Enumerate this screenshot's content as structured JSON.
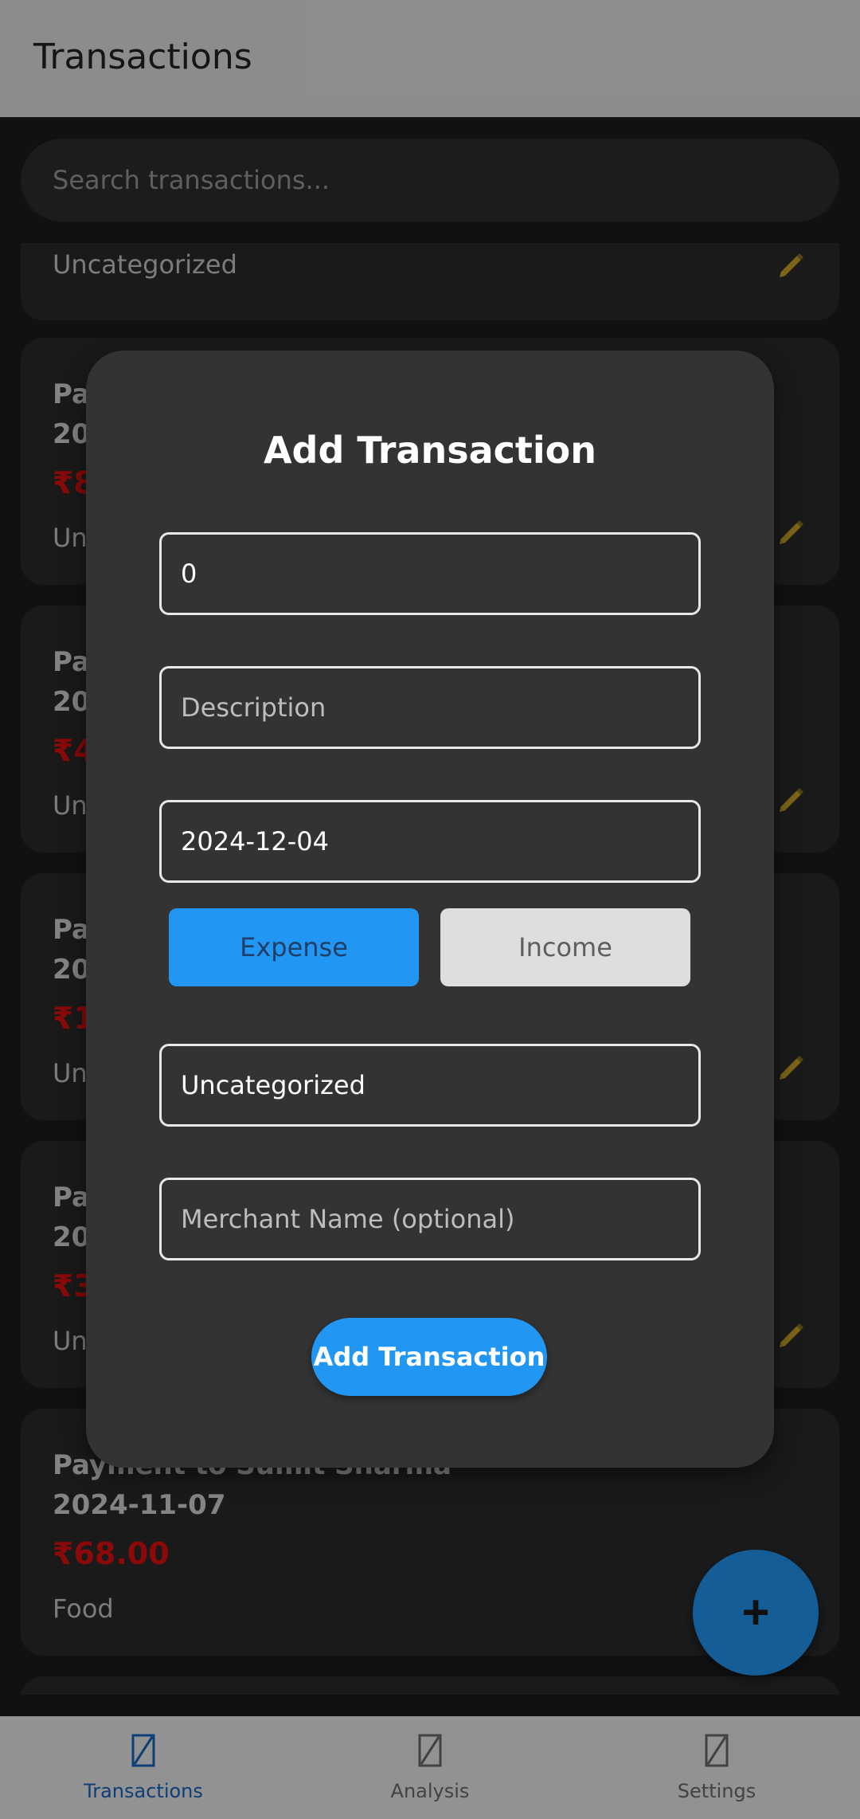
{
  "app_bar": {
    "title": "Transactions"
  },
  "search": {
    "placeholder": "Search transactions..."
  },
  "transactions": [
    {
      "title": "",
      "date": "",
      "amount": "",
      "category": "Uncategorized"
    },
    {
      "title": "Pa",
      "date": "20",
      "amount": "₹8",
      "category": "Un"
    },
    {
      "title": "Pa",
      "date": "20",
      "amount": "₹4",
      "category": "Un"
    },
    {
      "title": "Pa",
      "date": "20",
      "amount": "₹1",
      "category": "Un"
    },
    {
      "title": "Pa",
      "date": "20",
      "amount": "₹3",
      "category": "Un"
    },
    {
      "title": "Payment to Sumit Sharma",
      "date": "2024-11-07",
      "amount": "₹68.00",
      "category": "Food"
    }
  ],
  "fab": {
    "icon": "plus-icon",
    "glyph": "+"
  },
  "bottom_nav": [
    {
      "label": "Transactions",
      "icon": "transactions-icon",
      "active": true
    },
    {
      "label": "Analysis",
      "icon": "analysis-icon",
      "active": false
    },
    {
      "label": "Settings",
      "icon": "settings-icon",
      "active": false
    }
  ],
  "dialog": {
    "title": "Add Transaction",
    "amount_value": "0",
    "description_placeholder": "Description",
    "date_value": "2024-12-04",
    "type_options": {
      "expense": "Expense",
      "income": "Income",
      "selected": "Expense"
    },
    "category_value": "Uncategorized",
    "merchant_placeholder": "Merchant Name (optional)",
    "submit_label": "Add Transaction"
  },
  "colors": {
    "accent": "#2196f3",
    "expense_red": "#e01010",
    "dialog_bg": "#333333",
    "edit_icon": "#c9a227"
  }
}
